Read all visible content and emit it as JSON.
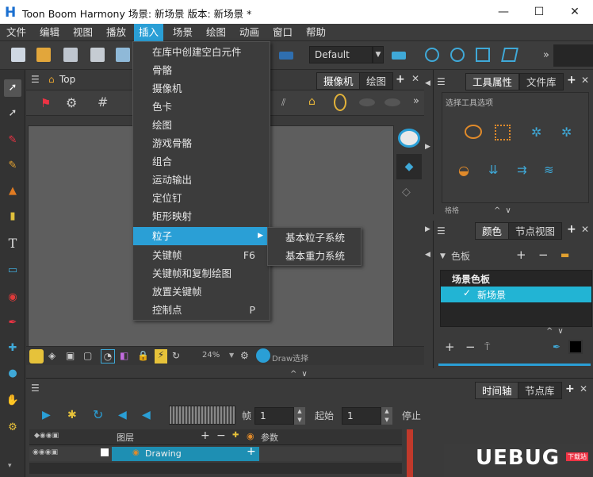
{
  "window": {
    "title": "Toon Boom Harmony 场景: 新场景 版本: 新场景 *",
    "logo": "H",
    "minimize": "—",
    "maximize": "☐",
    "close": "✕"
  },
  "menubar": [
    "文件",
    "编辑",
    "视图",
    "播放",
    "插入",
    "场景",
    "绘图",
    "动画",
    "窗口",
    "帮助"
  ],
  "toolbar": {
    "preset_value": "Default",
    "overflow": "»"
  },
  "insert_menu": {
    "items": [
      {
        "label": "在库中创建空白元件",
        "shortcut": ""
      },
      {
        "label": "骨骼",
        "shortcut": ""
      },
      {
        "label": "摄像机",
        "shortcut": ""
      },
      {
        "label": "色卡",
        "shortcut": ""
      },
      {
        "label": "绘图",
        "shortcut": ""
      },
      {
        "label": "游戏骨骼",
        "shortcut": ""
      },
      {
        "label": "组合",
        "shortcut": ""
      },
      {
        "label": "运动输出",
        "shortcut": ""
      },
      {
        "label": "定位钉",
        "shortcut": ""
      },
      {
        "label": "矩形映射",
        "shortcut": ""
      },
      {
        "label": "粒子",
        "shortcut": "",
        "submenu": true
      },
      {
        "label": "关键帧",
        "shortcut": "F6"
      },
      {
        "label": "关键帧和复制绘图",
        "shortcut": ""
      },
      {
        "label": "放置关键帧",
        "shortcut": ""
      },
      {
        "label": "控制点",
        "shortcut": "P"
      }
    ],
    "submenu_items": [
      "基本粒子系统",
      "基本重力系统"
    ]
  },
  "view_panel": {
    "breadcrumb": "Top",
    "tabs": [
      "摄像机",
      "绘图"
    ],
    "zoom": "24%",
    "status_label": "Draw选择"
  },
  "tool_props": {
    "tabs": [
      "工具属性",
      "文件库"
    ],
    "section_title": "选择工具选项",
    "bottom_label": "格格"
  },
  "palette_panel": {
    "tabs": [
      "颜色",
      "节点视图"
    ],
    "palette_label": "色板",
    "list_header": "场景色板",
    "list_item": "新场景",
    "accent": "#2a9fd6",
    "selected_bg": "#22b4d4"
  },
  "timeline": {
    "tabs": [
      "时间轴",
      "节点库"
    ],
    "frame_label": "帧",
    "frame_value": "1",
    "start_label": "起始",
    "start_value": "1",
    "stop_label": "停止",
    "layers_header": "图层",
    "params_header": "参数",
    "layer_name": "Drawing"
  },
  "watermark": {
    "text": "UEBUG",
    "sub": "下载站"
  }
}
